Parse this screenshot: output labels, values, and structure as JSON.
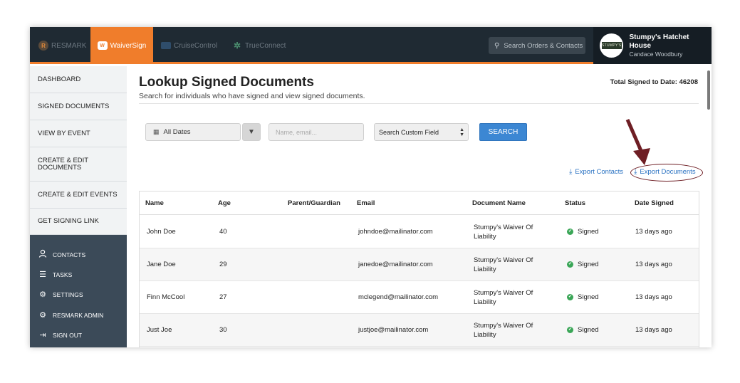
{
  "topbar": {
    "products": [
      {
        "label": "RESMARK",
        "icon": "resmark-logo-icon"
      },
      {
        "label": "WaiverSign",
        "icon": "waiversign-logo-icon",
        "active": true
      },
      {
        "label": "CruiseControl",
        "icon": "cruisecontrol-logo-icon"
      },
      {
        "label": "TrueConnect",
        "icon": "trueconnect-logo-icon"
      }
    ],
    "search_placeholder": "Search Orders & Contacts",
    "account": {
      "business": "Stumpy's Hatchet House",
      "user": "Candace Woodbury",
      "logo_text": "STUMPY'S"
    },
    "accent_color": "#f07d2b"
  },
  "sidebar": {
    "items": [
      {
        "label": "DASHBOARD"
      },
      {
        "label": "SIGNED DOCUMENTS"
      },
      {
        "label": "VIEW BY EVENT"
      },
      {
        "label": "CREATE & EDIT DOCUMENTS"
      },
      {
        "label": "CREATE & EDIT EVENTS"
      },
      {
        "label": "GET SIGNING LINK"
      }
    ],
    "secondary": [
      {
        "label": "CONTACTS",
        "icon": "user-icon"
      },
      {
        "label": "TASKS",
        "icon": "list-icon"
      },
      {
        "label": "SETTINGS",
        "icon": "gear-icon"
      },
      {
        "label": "RESMARK ADMIN",
        "icon": "gears-icon"
      },
      {
        "label": "SIGN OUT",
        "icon": "sign-out-icon"
      }
    ]
  },
  "main": {
    "title": "Lookup Signed Documents",
    "subtitle": "Search for individuals who have signed and view signed documents.",
    "total_label": "Total Signed to Date: 46208",
    "filters": {
      "date_range": "All Dates",
      "search_placeholder": "Name, email...",
      "custom_field": "Search Custom Field",
      "search_button": "SEARCH"
    },
    "exports": {
      "contacts": "Export Contacts",
      "documents": "Export Documents"
    },
    "table": {
      "headers": [
        "Name",
        "Age",
        "Parent/Guardian",
        "Email",
        "Document Name",
        "Status",
        "Date Signed"
      ],
      "rows": [
        {
          "name": "John Doe",
          "age": "40",
          "guardian": "",
          "email": "johndoe@mailinator.com",
          "document": "Stumpy's Waiver Of Liability",
          "status": "Signed",
          "date": "13 days ago"
        },
        {
          "name": "Jane Doe",
          "age": "29",
          "guardian": "",
          "email": "janedoe@mailinator.com",
          "document": "Stumpy's Waiver Of Liability",
          "status": "Signed",
          "date": "13 days ago"
        },
        {
          "name": "Finn McCool",
          "age": "27",
          "guardian": "",
          "email": "mclegend@mailinator.com",
          "document": "Stumpy's Waiver Of Liability",
          "status": "Signed",
          "date": "13 days ago"
        },
        {
          "name": "Just Joe",
          "age": "30",
          "guardian": "",
          "email": "justjoe@mailinator.com",
          "document": "Stumpy's Waiver Of Liability",
          "status": "Signed",
          "date": "13 days ago"
        }
      ]
    },
    "annotation_color": "#6e1e24",
    "status_color": "#3aa657",
    "link_color": "#2a72c2"
  }
}
